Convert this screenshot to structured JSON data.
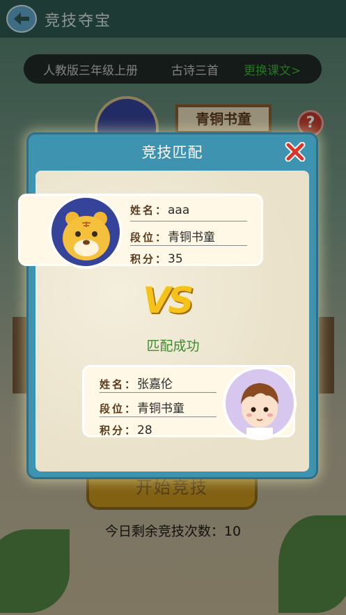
{
  "header": {
    "title": "竞技夺宝"
  },
  "course": {
    "grade": "人教版三年级上册",
    "lesson": "古诗三首",
    "change_label": "更换课文>"
  },
  "background": {
    "rank_badge": "青铜书童",
    "help": "?",
    "start_button": "开始竞技"
  },
  "remaining": {
    "label": "今日剩余竞技次数：",
    "count": "10"
  },
  "dialog": {
    "title": "竞技匹配",
    "status": "匹配成功",
    "vs": "VS",
    "player1": {
      "name_label": "姓名：",
      "name": "aaa",
      "rank_label": "段位：",
      "rank": "青铜书童",
      "score_label": "积分：",
      "score": "35",
      "avatar_icon": "tiger-avatar"
    },
    "player2": {
      "name_label": "姓名：",
      "name": "张嘉伦",
      "rank_label": "段位：",
      "rank": "青铜书童",
      "score_label": "积分：",
      "score": "28",
      "avatar_icon": "boy-avatar"
    }
  },
  "colors": {
    "accent_green": "#3fb13c",
    "dialog_blue": "#3e93b0",
    "vs_gold": "#f4c21a"
  }
}
